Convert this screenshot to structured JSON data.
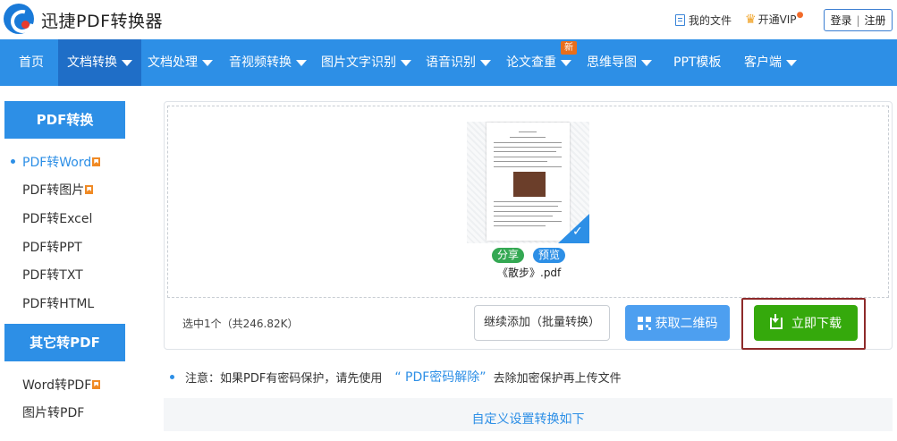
{
  "header": {
    "brand": "迅捷PDF转换器",
    "my_files": "我的文件",
    "vip": "开通VIP",
    "login": "登录",
    "divider": "|",
    "register": "注册"
  },
  "nav": {
    "items": [
      {
        "label": "首页",
        "has_caret": false
      },
      {
        "label": "文档转换",
        "has_caret": true,
        "active": true
      },
      {
        "label": "文档处理",
        "has_caret": true
      },
      {
        "label": "音视频转换",
        "has_caret": true
      },
      {
        "label": "图片文字识别",
        "has_caret": true
      },
      {
        "label": "语音识别",
        "has_caret": true
      },
      {
        "label": "论文查重",
        "has_caret": true
      },
      {
        "label": "思维导图",
        "has_caret": true
      },
      {
        "label": "PPT模板",
        "has_caret": false
      },
      {
        "label": "客户端",
        "has_caret": true
      }
    ],
    "new_badge": "新"
  },
  "sidebar": {
    "group1_title": "PDF转换",
    "group1_items": [
      "PDF转Word",
      "PDF转图片",
      "PDF转Excel",
      "PDF转PPT",
      "PDF转TXT",
      "PDF转HTML"
    ],
    "group2_title": "其它转PDF",
    "group2_items": [
      "Word转PDF",
      "图片转PDF"
    ]
  },
  "file": {
    "name": "《散步》.pdf",
    "share_label": "分享",
    "preview_label": "预览"
  },
  "actions": {
    "selected_summary": "选中1个（共246.82K）",
    "add_more": "继续添加（批量转换）",
    "qr": "获取二维码",
    "download": "立即下载"
  },
  "notice": {
    "prefix": "注意：如果PDF有密码保护，请先使用",
    "link": "“ PDF密码解除”",
    "suffix": "去除加密保护再上传文件"
  },
  "custom_settings": "自定义设置转换如下",
  "colors": {
    "primary": "#2d8fe6",
    "nav_active": "#1f6ec7",
    "download_green": "#35a90c",
    "highlight_frame": "#8e2a2a"
  }
}
